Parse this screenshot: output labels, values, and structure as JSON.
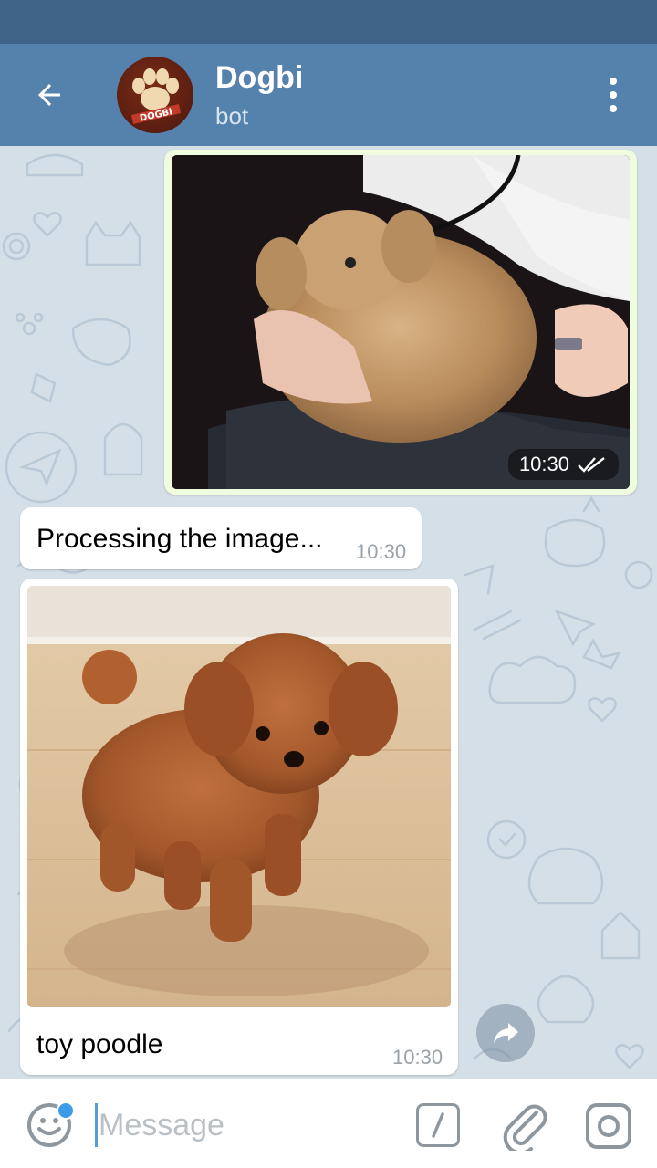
{
  "header": {
    "title": "Dogbi",
    "subtitle": "bot",
    "avatar_text": "DOGBI"
  },
  "messages": [
    {
      "type": "outgoing-photo",
      "time": "10:30",
      "status_icon": "double-check-icon",
      "image": "puppy held on lap"
    },
    {
      "type": "incoming-text",
      "text": "Processing the image...",
      "time": "10:30"
    },
    {
      "type": "incoming-photo",
      "caption": "toy poodle",
      "time": "10:30",
      "image": "toy poodle standing on floor"
    }
  ],
  "input": {
    "placeholder": "Message"
  },
  "icons": {
    "back": "arrow-left-icon",
    "menu": "more-vertical-icon",
    "share": "share-forward-icon",
    "emoji": "smile-icon",
    "commands": "slash-command-icon",
    "attach": "paperclip-icon",
    "camera": "instagram-camera-icon"
  },
  "colors": {
    "header": "#5582ad",
    "status_bar": "#3f6488",
    "chat_bg": "#d5dfe8",
    "outgoing_bubble": "#effcdd",
    "incoming_bubble": "#ffffff",
    "accent": "#3d9ce8"
  }
}
